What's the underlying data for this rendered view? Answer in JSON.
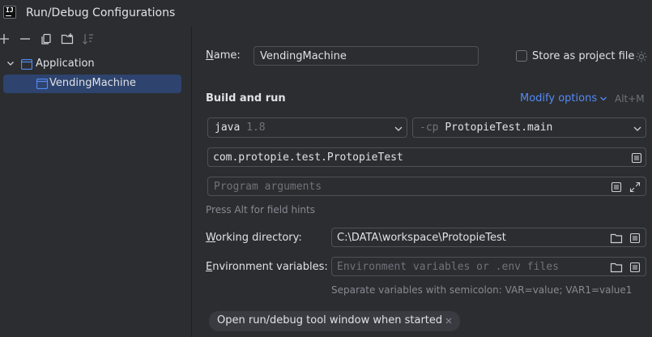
{
  "window": {
    "title": "Run/Debug Configurations",
    "logo_text": "IJ"
  },
  "toolbar": {
    "icons": [
      "add-icon",
      "remove-icon",
      "copy-icon",
      "new-folder-icon",
      "sort-icon"
    ]
  },
  "tree": {
    "group_label": "Application",
    "item_label": "VendingMachine"
  },
  "form": {
    "name_label_prefix": "N",
    "name_label_rest": "ame:",
    "name_value": "VendingMachine",
    "store_label": "Store as project file",
    "build_and_run_title": "Build and run",
    "modify_options_label": "Modify options",
    "modify_options_shortcut": "Alt+M",
    "jdk_name": "java",
    "jdk_version": "1.8",
    "cp_flag": "-cp",
    "cp_value": "ProtopieTest.main",
    "main_class": "com.protopie.test.ProtopieTest",
    "program_args_placeholder": "Program arguments",
    "field_hints": "Press Alt for field hints",
    "working_dir_label_prefix": "W",
    "working_dir_label_rest": "orking directory:",
    "working_dir_value": "C:\\DATA\\workspace\\ProtopieTest",
    "env_label_prefix": "E",
    "env_label_rest": "nvironment variables:",
    "env_placeholder": "Environment variables or .env files",
    "env_hint": "Separate variables with semicolon: VAR=value; VAR1=value1",
    "open_tool_window_chip": "Open run/debug tool window when started"
  },
  "colors": {
    "background": "#2b2d30",
    "selection": "#2e436e",
    "link": "#548af7",
    "border": "#4e5157"
  }
}
